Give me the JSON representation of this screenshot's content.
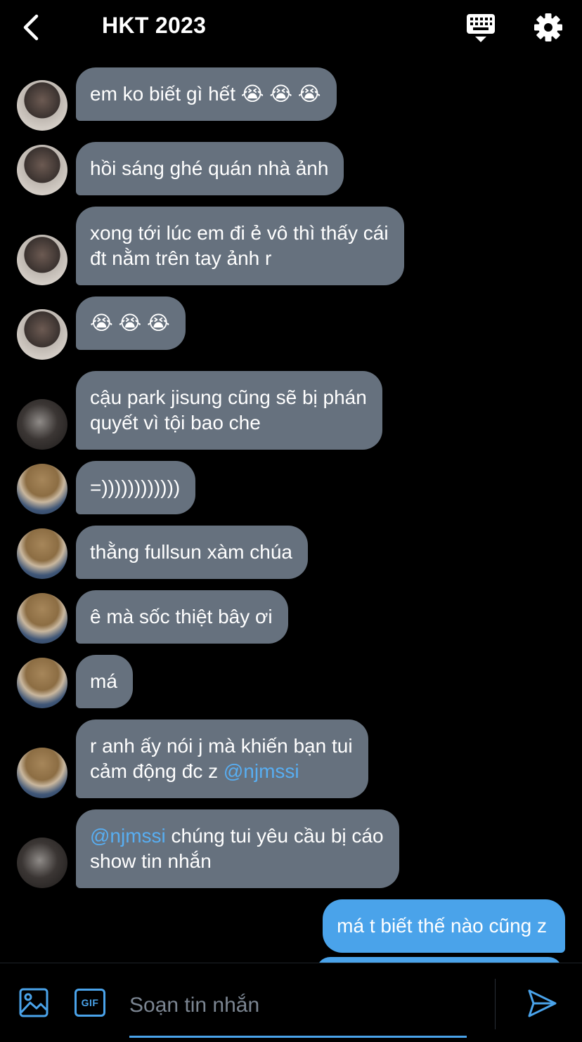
{
  "header": {
    "title": "HKT 2023"
  },
  "colors": {
    "background": "#000000",
    "incoming_bubble": "#66717e",
    "outgoing_bubble": "#4aa3ea",
    "accent": "#4aa3ea",
    "mention": "#58aef2"
  },
  "messages": [
    {
      "text": "em ko biết gì hết 😭 😭 😭",
      "direction": "incoming",
      "avatar": "user-a"
    },
    {
      "text": "hồi sáng ghé quán nhà ảnh",
      "direction": "incoming",
      "avatar": "user-a"
    },
    {
      "text": "xong tới lúc em đi ẻ vô thì thấy cái\nđt nằm trên tay ảnh r",
      "direction": "incoming",
      "avatar": "user-a"
    },
    {
      "text": "😭 😭 😭",
      "direction": "incoming",
      "avatar": "user-a"
    },
    {
      "text": "cậu park jisung cũng sẽ bị phán\nquyết vì tội bao che",
      "direction": "incoming",
      "avatar": "user-b"
    },
    {
      "text": "=))))))))))))",
      "direction": "incoming",
      "avatar": "user-c"
    },
    {
      "text": "thằng fullsun xàm chúa",
      "direction": "incoming",
      "avatar": "user-c"
    },
    {
      "text": "ê mà sốc thiệt bây ơi",
      "direction": "incoming",
      "avatar": "user-c"
    },
    {
      "text": "má",
      "direction": "incoming",
      "avatar": "user-c"
    },
    {
      "text_before": "r anh ấy nói j mà khiến bạn tui\ncảm động đc z ",
      "mention": "@njmssi",
      "text_after": "",
      "direction": "incoming",
      "avatar": "user-c"
    },
    {
      "text_before": "",
      "mention": "@njmssi",
      "text_after": " chúng tui yêu cầu bị cáo\nshow tin nhắn",
      "direction": "incoming",
      "avatar": "user-b"
    },
    {
      "text": "má t biết thế nào cũng z",
      "direction": "outgoing"
    }
  ],
  "composer": {
    "placeholder": "Soạn tin nhắn",
    "value": "",
    "gif_label": "GIF"
  },
  "icons": [
    "chevron-left-icon",
    "keyboard-icon",
    "gear-icon",
    "image-icon",
    "gif-icon",
    "send-icon"
  ]
}
